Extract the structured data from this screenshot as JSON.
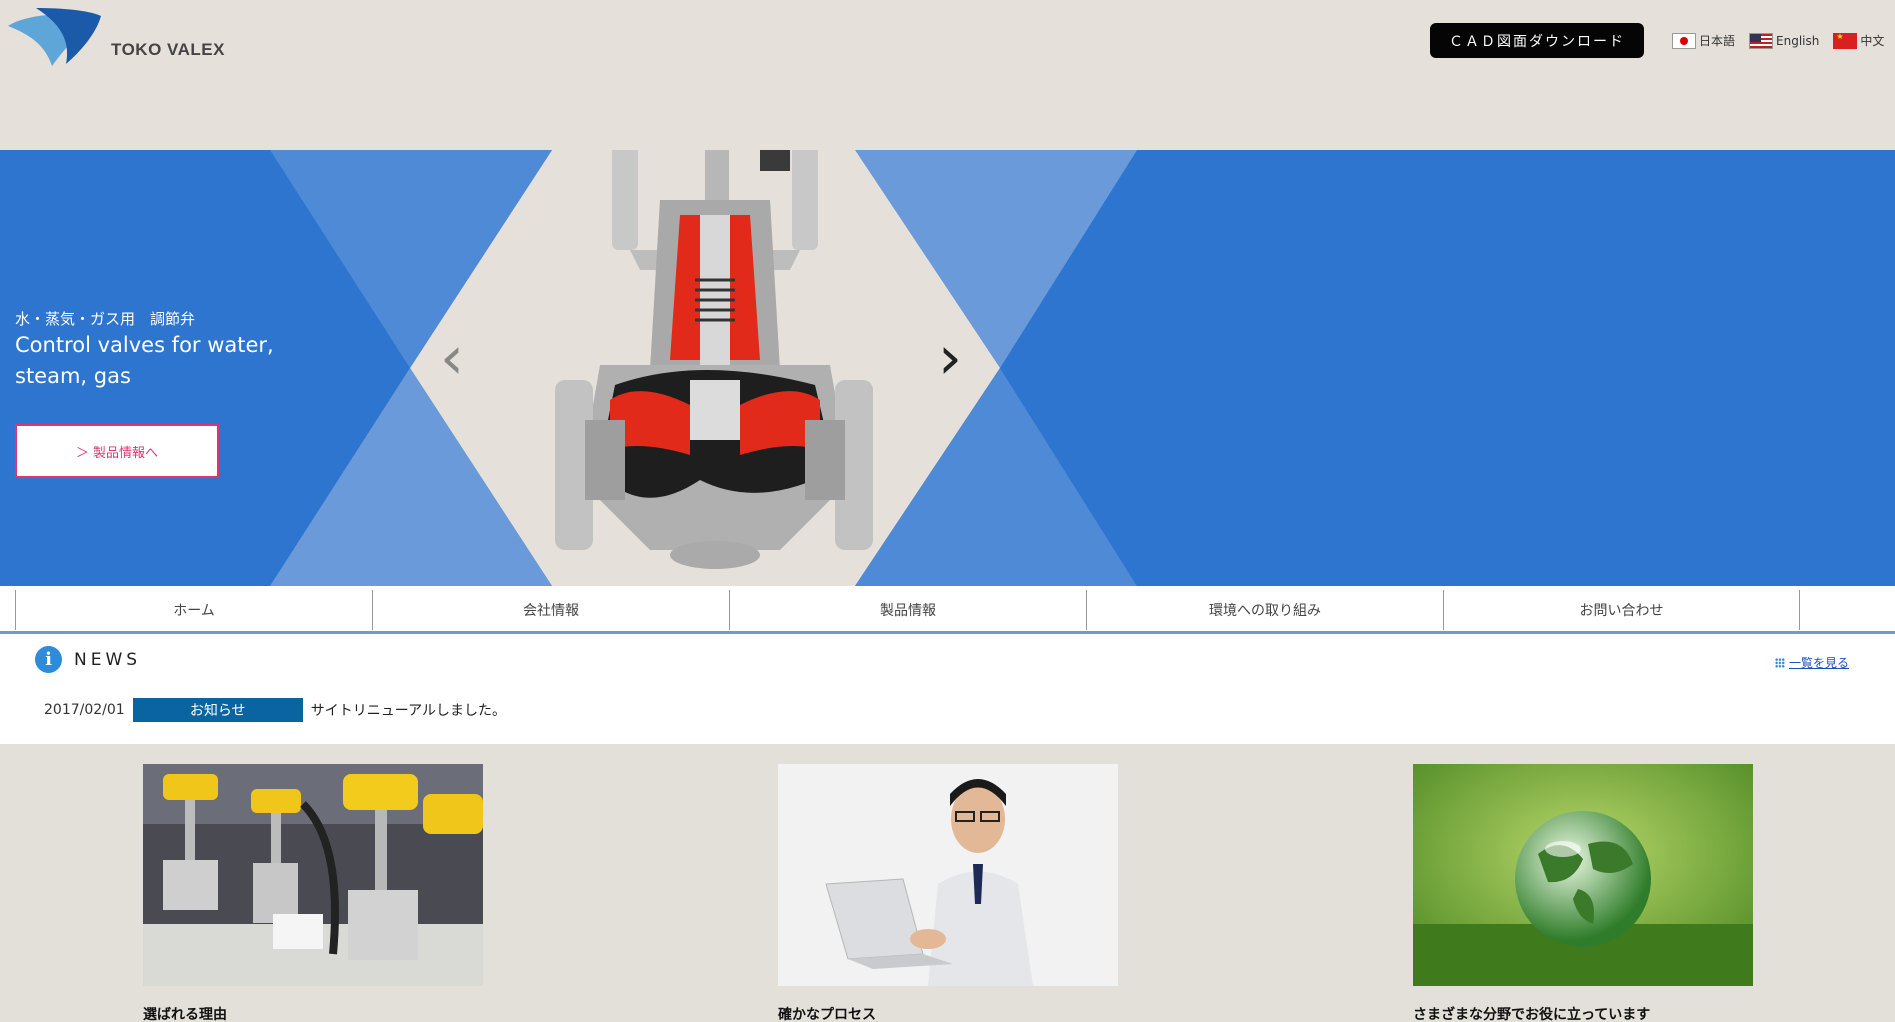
{
  "header": {
    "logo_text": "TOKO VALEX",
    "cad_button": "ＣＡＤ図面ダウンロード",
    "languages": [
      {
        "label": "日本語",
        "icon": "japan-flag-icon"
      },
      {
        "label": "English",
        "icon": "us-flag-icon"
      },
      {
        "label": "中文",
        "icon": "china-flag-icon"
      }
    ]
  },
  "hero": {
    "subtitle": "水・蒸気・ガス用　調節弁",
    "title": "Control valves for water, steam, gas",
    "button": "＞ 製品情報へ",
    "prev_arrow": "‹",
    "next_arrow": "›"
  },
  "nav": {
    "items": [
      "ホーム",
      "会社情報",
      "製品情報",
      "環境への取り組み",
      "お問い合わせ"
    ]
  },
  "news": {
    "title": "NEWS",
    "more_link": "一覧を見る",
    "items": [
      {
        "date": "2017/02/01",
        "category": "お知らせ",
        "text": "サイトリニューアルしました。"
      }
    ]
  },
  "features": [
    {
      "caption": "選ばれる理由"
    },
    {
      "caption": "確かなプロセス"
    },
    {
      "caption": "さまざまな分野でお役に立っています"
    }
  ],
  "colors": {
    "hero_blue": "#2e75cf",
    "hero_light": "#6a9ad9",
    "accent_pink": "#e0356c",
    "news_badge": "#0a64a0",
    "page_bg": "#e3e0d9"
  }
}
